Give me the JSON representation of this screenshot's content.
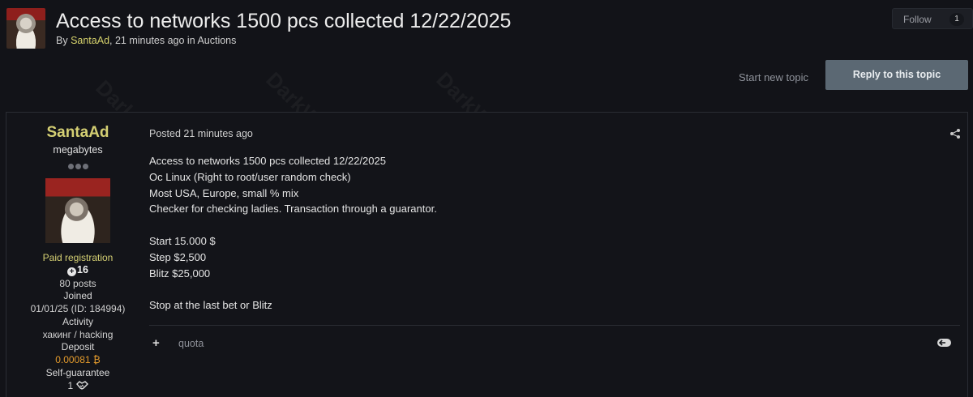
{
  "topic": {
    "title": "Access to networks 1500 pcs collected 12/22/2025",
    "byline_prefix": "By ",
    "author": "SantaAd",
    "time": ", 21 minutes ago in ",
    "forum": "Auctions"
  },
  "follow": {
    "label": "Follow",
    "count": "1"
  },
  "actions": {
    "start_new_topic": "Start new topic",
    "reply": "Reply to this topic"
  },
  "post": {
    "author": {
      "name": "SantaAd",
      "rank": "megabytes",
      "group": "Paid registration",
      "reputation": "16",
      "posts": "80 posts",
      "joined_label": "Joined",
      "joined_value": "01/01/25 (ID: 184994)",
      "activity_label": "Activity",
      "activity_value": "хакинг / hacking",
      "deposit_label": "Deposit",
      "deposit_value": "0.00081 ₿",
      "self_guarantee_label": "Self-guarantee",
      "self_guarantee_value": "1"
    },
    "posted": "Posted 21 minutes ago",
    "body": [
      "Access to networks 1500 pcs collected 12/22/2025",
      "Oc Linux (Right to root/user random check)",
      "Most USA, Europe, small % mix",
      "Checker for checking ladies. Transaction through a guarantor.",
      "",
      "Start 15.000 $",
      "Step $2,500",
      "Blitz $25,000",
      "",
      "Stop at the last bet or Blitz"
    ],
    "quote_label": "quota"
  },
  "watermark": "DarkWeb Informer",
  "icons": [
    "plus-icon",
    "share-icon",
    "multi-quote-icon",
    "handshake-icon",
    "reputation-plus-icon"
  ]
}
